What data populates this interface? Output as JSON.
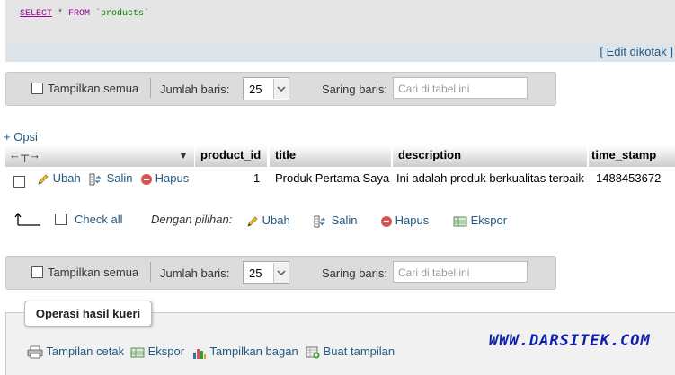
{
  "sql": {
    "query_select": "SELECT",
    "query_star": " * ",
    "query_from": "FROM",
    "query_table": " `products`",
    "edit_inline": "Edit dikotak"
  },
  "nav": {
    "show_all": "Tampilkan semua",
    "rows_label": "Jumlah baris:",
    "rows_value": "25",
    "filter_label": "Saring baris:",
    "filter_placeholder": "Cari di tabel ini"
  },
  "options_link": "+ Opsi",
  "table": {
    "columns": [
      "product_id",
      "title",
      "description",
      "time_stamp"
    ],
    "rows": [
      {
        "product_id": "1",
        "title": "Produk Pertama Saya",
        "description": "Ini adalah produk berkualitas terbaik",
        "time_stamp": "1488453672"
      }
    ],
    "row_actions": {
      "edit": "Ubah",
      "copy": "Salin",
      "delete": "Hapus"
    }
  },
  "bulk": {
    "check_all": "Check all",
    "with_selected": "Dengan pilihan:",
    "edit": "Ubah",
    "copy": "Salin",
    "delete": "Hapus",
    "export": "Ekspor"
  },
  "query_ops": {
    "title": "Operasi hasil kueri",
    "print": "Tampilan cetak",
    "export": "Ekspor",
    "chart": "Tampilkan bagan",
    "create_view": "Buat tampilan"
  },
  "watermark": "WWW.DARSITEK.COM",
  "colors": {
    "link": "#235a81",
    "delete_icon": "#d9534f",
    "watermark": "#0f1fa5"
  }
}
